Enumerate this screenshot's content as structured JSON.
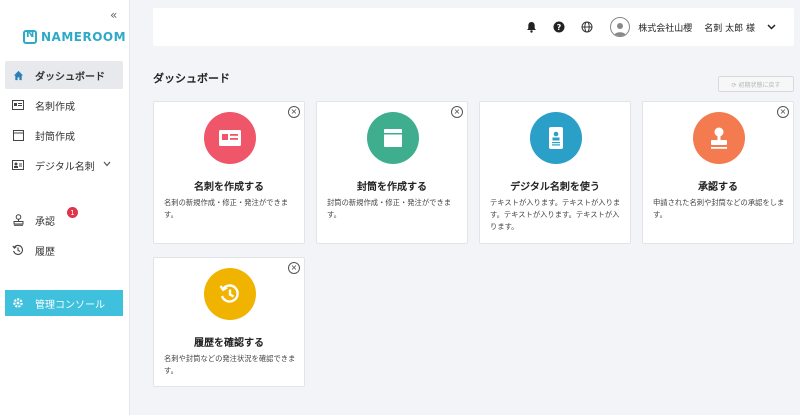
{
  "sidebar": {
    "collapse_label": "«",
    "logo_text": "NAMEROOM",
    "items": [
      {
        "label": "ダッシュボード",
        "icon": "home-icon"
      },
      {
        "label": "名刺作成",
        "icon": "card-icon"
      },
      {
        "label": "封筒作成",
        "icon": "envelope-icon"
      },
      {
        "label": "デジタル名刺",
        "icon": "id-card-icon"
      },
      {
        "label": "承認",
        "icon": "stamp-icon",
        "badge": "1"
      },
      {
        "label": "履歴",
        "icon": "history-icon"
      }
    ],
    "admin_label": "管理コンソール"
  },
  "header": {
    "company": "株式会社山櫻",
    "user": "名刺 太郎 様",
    "icons": [
      "bell-icon",
      "help-icon",
      "globe-icon",
      "avatar-icon",
      "chevron-down-icon"
    ]
  },
  "main": {
    "title": "ダッシュボード",
    "reset_label": "⟳ 初期状態に戻す",
    "cards": [
      {
        "title": "名刺を作成する",
        "desc": "名刺の新規作成・修正・発注ができます。",
        "color": "#f0566a"
      },
      {
        "title": "封筒を作成する",
        "desc": "封筒の新規作成・修正・発注ができます。",
        "color": "#3fae8e"
      },
      {
        "title": "デジタル名刺を使う",
        "desc": "テキストが入ります。テキストが入ります。テキストが入ります。テキストが入ります。",
        "color": "#2a9fc8"
      },
      {
        "title": "承認する",
        "desc": "申請された名刺や封筒などの承認をします。",
        "color": "#f47b50"
      },
      {
        "title": "履歴を確認する",
        "desc": "名刺や封筒などの発注状況を確認できます。",
        "color": "#f0b400"
      }
    ]
  }
}
